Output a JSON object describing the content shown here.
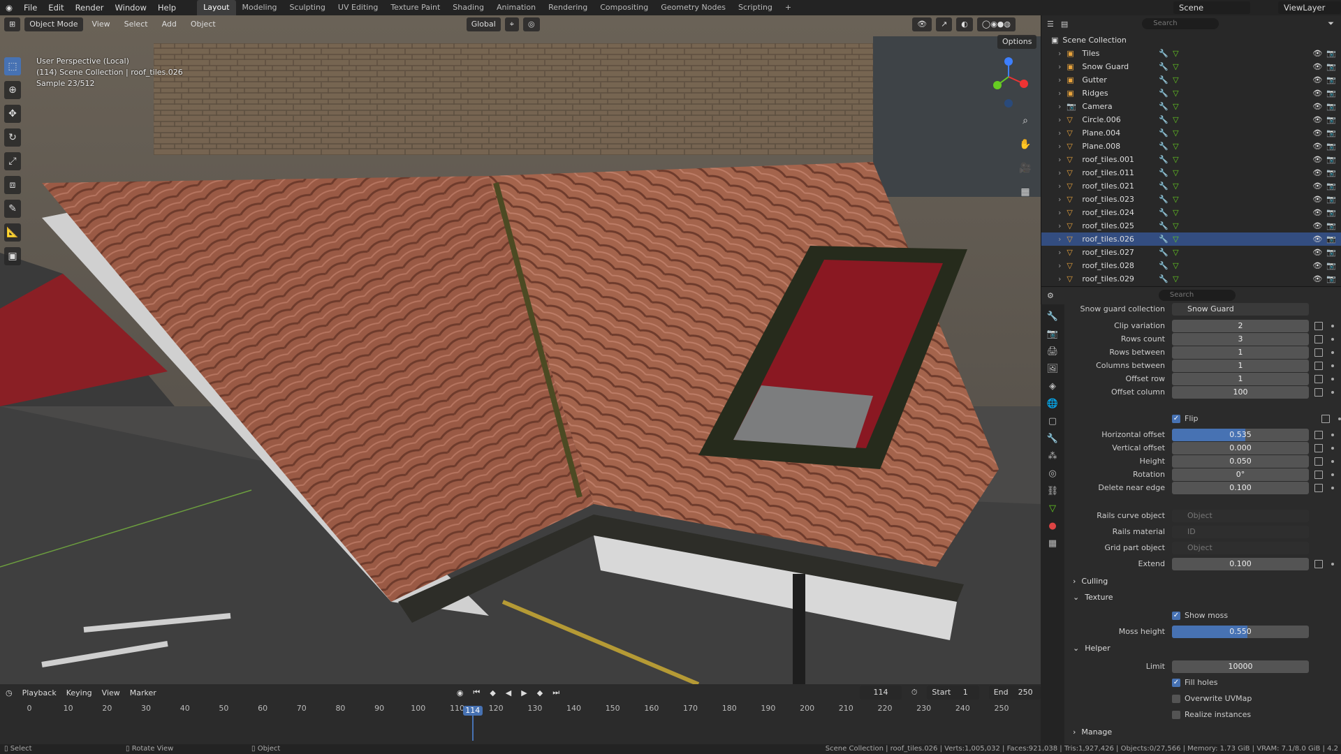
{
  "menu": [
    "File",
    "Edit",
    "Render",
    "Window",
    "Help"
  ],
  "workspaces": [
    "Layout",
    "Modeling",
    "Sculpting",
    "UV Editing",
    "Texture Paint",
    "Shading",
    "Animation",
    "Rendering",
    "Compositing",
    "Geometry Nodes",
    "Scripting"
  ],
  "active_workspace": "Layout",
  "scene_name": "Scene",
  "view_layer": "ViewLayer",
  "viewport": {
    "mode": "Object Mode",
    "menus": [
      "View",
      "Select",
      "Add",
      "Object"
    ],
    "transform": "Global",
    "options": "Options",
    "overlay_line1": "User Perspective (Local)",
    "overlay_line2": "(114) Scene Collection | roof_tiles.026",
    "overlay_line3": "Sample 23/512"
  },
  "outliner": {
    "search_placeholder": "Search",
    "root": "Scene Collection",
    "items": [
      {
        "name": "Tiles"
      },
      {
        "name": "Snow Guard"
      },
      {
        "name": "Gutter"
      },
      {
        "name": "Ridges"
      },
      {
        "name": "Camera"
      },
      {
        "name": "Circle.006"
      },
      {
        "name": "Plane.004"
      },
      {
        "name": "Plane.008"
      },
      {
        "name": "roof_tiles.001"
      },
      {
        "name": "roof_tiles.011"
      },
      {
        "name": "roof_tiles.021"
      },
      {
        "name": "roof_tiles.023"
      },
      {
        "name": "roof_tiles.024"
      },
      {
        "name": "roof_tiles.025"
      },
      {
        "name": "roof_tiles.026"
      },
      {
        "name": "roof_tiles.027"
      },
      {
        "name": "roof_tiles.028"
      },
      {
        "name": "roof_tiles.029"
      }
    ]
  },
  "properties": {
    "search_placeholder": "Search",
    "top_label": "Snow guard collection",
    "top_value": "Snow Guard",
    "rows": [
      {
        "label": "Clip variation",
        "value": "2"
      },
      {
        "label": "Rows count",
        "value": "3"
      },
      {
        "label": "Rows between",
        "value": "1"
      },
      {
        "label": "Columns between",
        "value": "1"
      },
      {
        "label": "Offset row",
        "value": "1"
      },
      {
        "label": "Offset column",
        "value": "100"
      }
    ],
    "flip_label": "Flip",
    "rows2": [
      {
        "label": "Horizontal offset",
        "value": "0.535",
        "fill": 0.535
      },
      {
        "label": "Vertical offset",
        "value": "0.000"
      },
      {
        "label": "Height",
        "value": "0.050"
      },
      {
        "label": "Rotation",
        "value": "0°"
      },
      {
        "label": "Delete near edge",
        "value": "0.100"
      }
    ],
    "rails_curve_label": "Rails curve object",
    "rails_curve_placeholder": "Object",
    "rails_material_label": "Rails material",
    "rails_material_placeholder": "ID",
    "grid_part_label": "Grid part object",
    "grid_part_placeholder": "Object",
    "extend_label": "Extend",
    "extend_value": "0.100",
    "culling": "Culling",
    "texture": "Texture",
    "show_moss": "Show moss",
    "moss_height_label": "Moss height",
    "moss_height": "0.550",
    "moss_fill": 0.55,
    "helper": "Helper",
    "limit_label": "Limit",
    "limit_value": "10000",
    "fill_holes": "Fill holes",
    "overwrite_uvmap": "Overwrite UVMap",
    "realize_instances": "Realize instances",
    "manage": "Manage"
  },
  "timeline": {
    "menus": [
      "Playback",
      "Keying",
      "View",
      "Marker"
    ],
    "current_frame": "114",
    "start_label": "Start",
    "start": "1",
    "end_label": "End",
    "end": "250",
    "ticks": [
      "0",
      "10",
      "20",
      "30",
      "40",
      "50",
      "60",
      "70",
      "80",
      "90",
      "100",
      "110",
      "120",
      "130",
      "140",
      "150",
      "160",
      "170",
      "180",
      "190",
      "200",
      "210",
      "220",
      "230",
      "240",
      "250"
    ],
    "playhead": "114"
  },
  "status": {
    "left1": "Select",
    "left2": "Rotate View",
    "left3": "Object",
    "right": "Scene Collection | roof_tiles.026 | Verts:1,005,032 | Faces:921,038 | Tris:1,927,426 | Objects:0/27,566 | Memory: 1.73 GiB | VRAM: 7.1/8.0 GiB | 4.2"
  }
}
